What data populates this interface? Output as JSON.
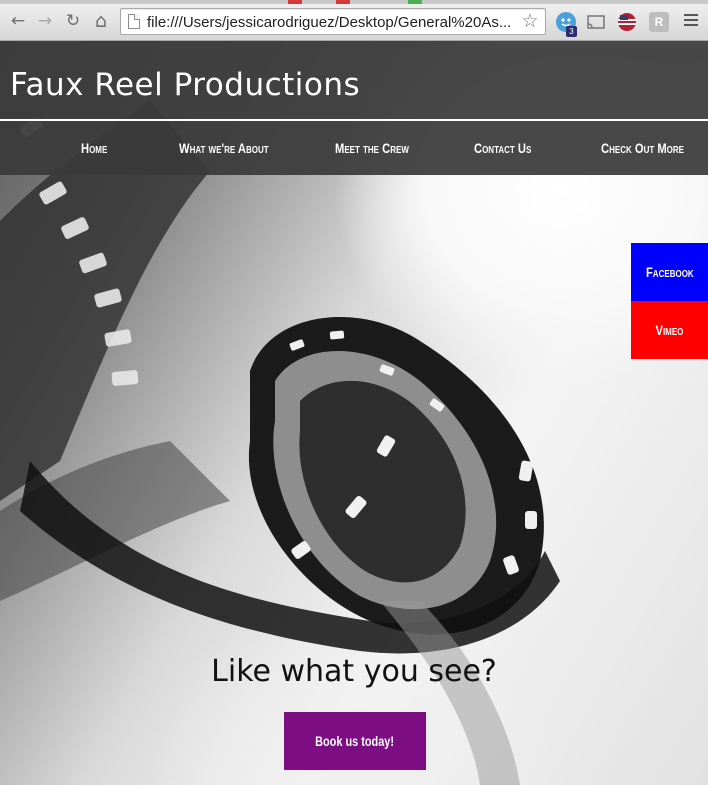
{
  "browser": {
    "url": "file:///Users/jessicarodriguez/Desktop/General%20As...",
    "extension_badge": "3",
    "icons": [
      "back-icon",
      "forward-icon",
      "reload-icon",
      "home-icon",
      "page-icon",
      "bookmark-star-icon",
      "extension-icon",
      "cast-icon",
      "flag-extension-icon",
      "reader-extension-icon",
      "menu-icon"
    ],
    "back_glyph": "←",
    "forward_glyph": "→",
    "reload_glyph": "↻",
    "home_glyph": "⌂",
    "star_glyph": "☆",
    "reader_glyph": "R"
  },
  "site": {
    "title": "Faux Reel Productions",
    "header_color": "#3a3a3a"
  },
  "nav": {
    "items": [
      {
        "label": "Home"
      },
      {
        "label": "What we're About"
      },
      {
        "label": "Meet the Crew"
      },
      {
        "label": "Contact Us"
      },
      {
        "label": "Check Out More"
      }
    ]
  },
  "social": {
    "facebook": {
      "label": "Facebook",
      "color": "#0000ff"
    },
    "vimeo": {
      "label": "Vimeo",
      "color": "#ff0000"
    }
  },
  "cta": {
    "heading": "Like what you see?",
    "button_label": "Book us today!",
    "button_color": "#7d0d82"
  }
}
